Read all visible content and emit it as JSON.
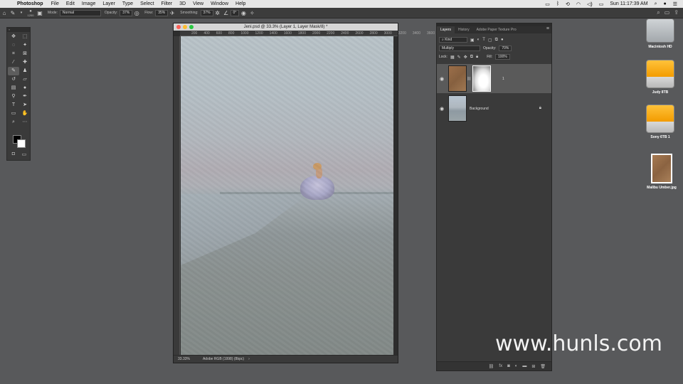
{
  "menubar": {
    "app_name": "Photoshop",
    "items": [
      "File",
      "Edit",
      "Image",
      "Layer",
      "Type",
      "Select",
      "Filter",
      "3D",
      "View",
      "Window",
      "Help"
    ],
    "clock": "Sun 11:17:39 AM"
  },
  "options_bar": {
    "brush_size": "1200",
    "mode_label": "Mode:",
    "mode_value": "Normal",
    "opacity_label": "Opacity:",
    "opacity_value": "37%",
    "flow_label": "Flow:",
    "flow_value": "35%",
    "smoothing_label": "Smoothing:",
    "smoothing_value": "37%",
    "angle_value": "0°"
  },
  "document": {
    "title": "Jeni.psd @ 33.3% (Layer 1, Layer Mask/8) *",
    "ruler_marks": [
      "200",
      "400",
      "600",
      "800",
      "1000",
      "1200",
      "1400",
      "1600",
      "1800",
      "2000",
      "2200",
      "2400",
      "2600",
      "2800",
      "3000",
      "3200",
      "3400",
      "3600"
    ],
    "zoom": "33.33%",
    "color_profile": "Adobe RGB (1998) (8bpc)"
  },
  "layers_panel": {
    "tabs": [
      "Layers",
      "History",
      "Adobe Paper Texture Pro"
    ],
    "kind_label": "Kind",
    "blend_mode": "Multiply",
    "opacity_label": "Opacity:",
    "opacity_value": "70%",
    "lock_label": "Lock:",
    "fill_label": "Fill:",
    "fill_value": "100%",
    "layers": [
      {
        "name": "1",
        "selected": true
      },
      {
        "name": "Background",
        "selected": false
      }
    ],
    "footer_icons": [
      "link-icon",
      "fx-icon",
      "mask-icon",
      "adjustment-icon",
      "folder-icon",
      "new-layer-icon",
      "trash-icon"
    ]
  },
  "desktop": {
    "items": [
      {
        "label": "Macintosh HD",
        "kind": "internal"
      },
      {
        "label": "Judy 8TB",
        "kind": "ext"
      },
      {
        "label": "Sony 6TB 1",
        "kind": "ext"
      },
      {
        "label": "Malibu Umber.jpg",
        "kind": "jpg"
      }
    ]
  },
  "watermark": "www.hunls.com",
  "colors": {
    "desktop_bg": "#58595b",
    "panel_bg": "#3a3a3a",
    "drive_accent": "#f39c00"
  }
}
